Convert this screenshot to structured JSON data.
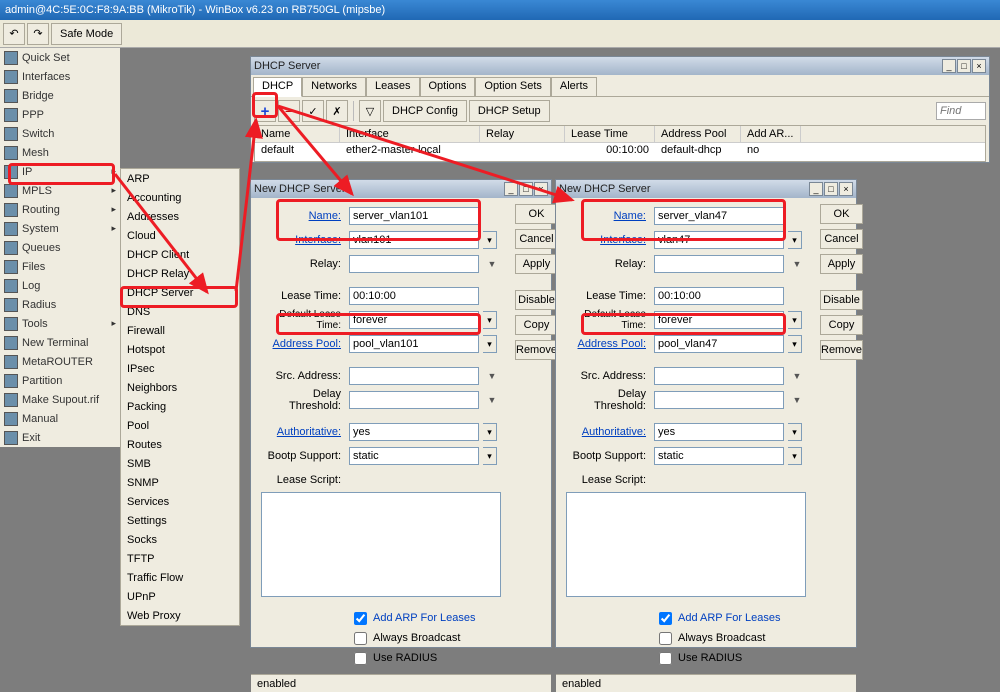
{
  "titlebar": "admin@4C:5E:0C:F8:9A:BB (MikroTik) - WinBox v6.23 on RB750GL (mipsbe)",
  "safe_mode": "Safe Mode",
  "sidebar": [
    "Quick Set",
    "Interfaces",
    "Bridge",
    "PPP",
    "Switch",
    "Mesh",
    "IP",
    "MPLS",
    "Routing",
    "System",
    "Queues",
    "Files",
    "Log",
    "Radius",
    "Tools",
    "New Terminal",
    "MetaROUTER",
    "Partition",
    "Make Supout.rif",
    "Manual",
    "Exit"
  ],
  "ip_submenu": [
    "ARP",
    "Accounting",
    "Addresses",
    "Cloud",
    "DHCP Client",
    "DHCP Relay",
    "DHCP Server",
    "DNS",
    "Firewall",
    "Hotspot",
    "IPsec",
    "Neighbors",
    "Packing",
    "Pool",
    "Routes",
    "SMB",
    "SNMP",
    "Services",
    "Settings",
    "Socks",
    "TFTP",
    "Traffic Flow",
    "UPnP",
    "Web Proxy"
  ],
  "dhcp_window": {
    "title": "DHCP Server",
    "tabs": [
      "DHCP",
      "Networks",
      "Leases",
      "Options",
      "Option Sets",
      "Alerts"
    ],
    "dhcp_config": "DHCP Config",
    "dhcp_setup": "DHCP Setup",
    "find_ph": "Find",
    "cols": {
      "name": "Name",
      "interface": "Interface",
      "relay": "Relay",
      "lease": "Lease Time",
      "pool": "Address Pool",
      "addarp": "Add AR..."
    },
    "row": {
      "name": "default",
      "interface": "ether2-master-local",
      "relay": "",
      "lease": "00:10:00",
      "pool": "default-dhcp",
      "addarp": "no"
    }
  },
  "dlg_labels": {
    "name": "Name:",
    "interface": "Interface:",
    "relay": "Relay:",
    "lease": "Lease Time:",
    "dlease": "Default Lease Time:",
    "pool": "Address Pool:",
    "src": "Src. Address:",
    "delay": "Delay Threshold:",
    "auth": "Authoritative:",
    "bootp": "Bootp Support:",
    "script": "Lease Script:"
  },
  "dlg_btns": {
    "ok": "OK",
    "cancel": "Cancel",
    "apply": "Apply",
    "disable": "Disable",
    "copy": "Copy",
    "remove": "Remove"
  },
  "chk_labels": {
    "arp": "Add ARP For Leases",
    "bcast": "Always Broadcast",
    "radius": "Use RADIUS"
  },
  "status": "enabled",
  "dlg1": {
    "title": "New DHCP Server",
    "name": "server_vlan101",
    "interface": "vlan101",
    "lease": "00:10:00",
    "dlease": "forever",
    "pool": "pool_vlan101",
    "auth": "yes",
    "bootp": "static"
  },
  "dlg2": {
    "title": "New DHCP Server",
    "name": "server_vlan47",
    "interface": "vlan47",
    "lease": "00:10:00",
    "dlease": "forever",
    "pool": "pool_vlan47",
    "auth": "yes",
    "bootp": "static"
  }
}
